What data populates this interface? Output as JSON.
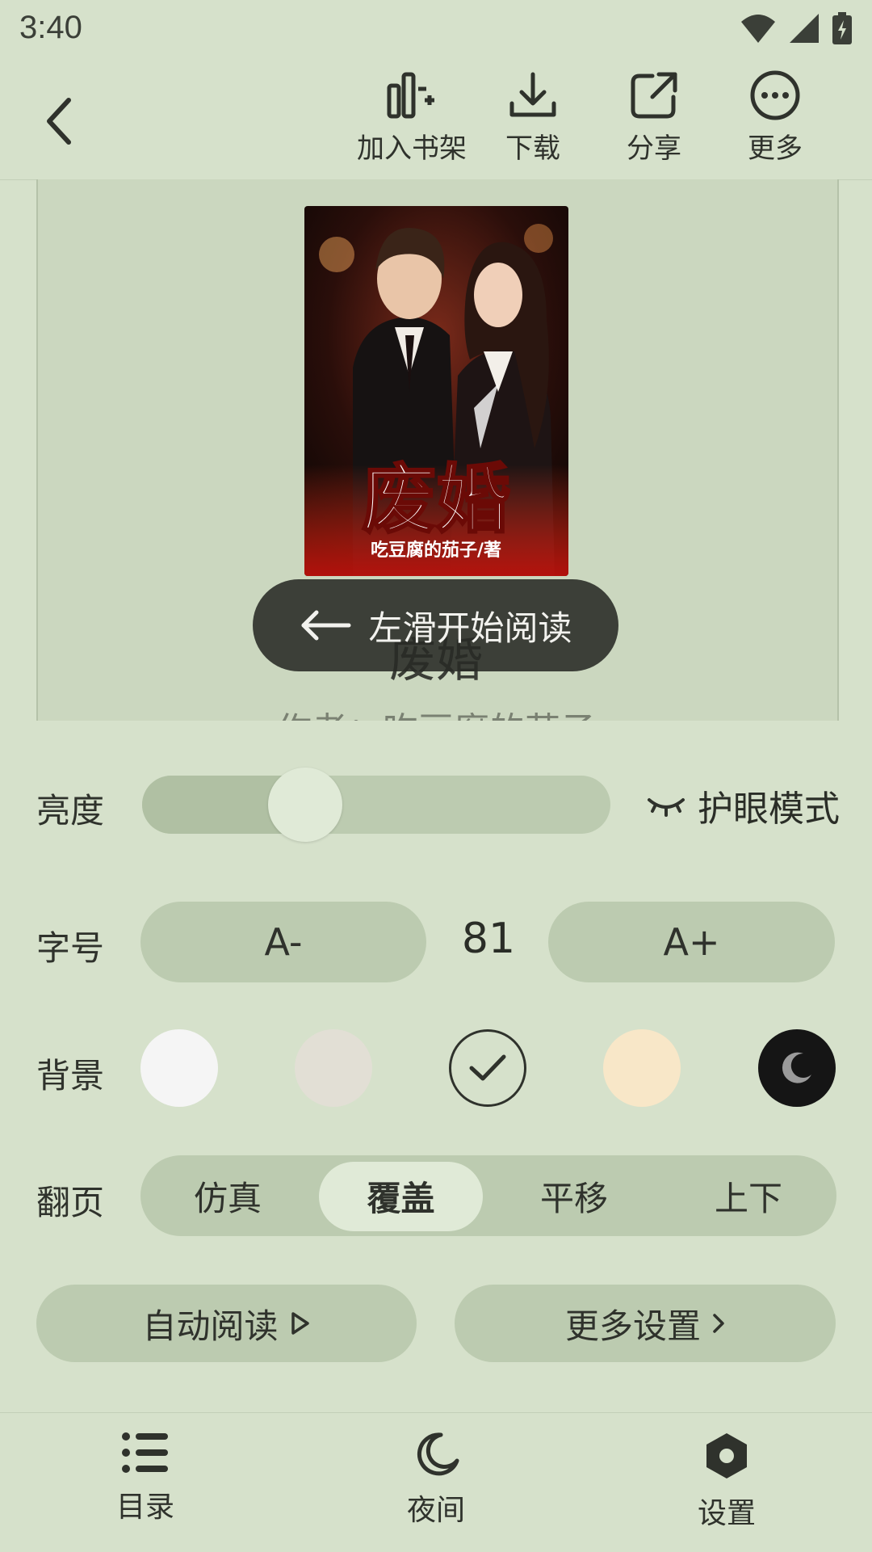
{
  "status_bar": {
    "time": "3:40"
  },
  "toolbar": {
    "back_icon": "chevron-left-icon",
    "actions": [
      {
        "label": "加入书架",
        "icon": "add-bookshelf-icon"
      },
      {
        "label": "下载",
        "icon": "download-icon"
      },
      {
        "label": "分享",
        "icon": "share-icon"
      },
      {
        "label": "更多",
        "icon": "more-icon"
      }
    ]
  },
  "book": {
    "cover_title": "废婚",
    "cover_author_line": "吃豆腐的茄子/著",
    "title": "废婚",
    "author": "作者：吃豆腐的茄子"
  },
  "swipe_hint": {
    "text": "左滑开始阅读",
    "icon": "arrow-left-icon"
  },
  "settings": {
    "brightness": {
      "label": "亮度",
      "level": 0.33,
      "eye_mode_label": "护眼模式",
      "eye_icon": "eye-closed-icon"
    },
    "font_size": {
      "label": "字号",
      "decrease": "A-",
      "value": "81",
      "increase": "A+"
    },
    "background": {
      "label": "背景",
      "swatches": [
        {
          "color": "#f5f5f5"
        },
        {
          "color": "#e2dfd5"
        },
        {
          "color": "#d6e1cb",
          "selected": true
        },
        {
          "color": "#f8e7c8"
        },
        {
          "color": "#151515",
          "icon": "moon-icon"
        }
      ]
    },
    "page_flip": {
      "label": "翻页",
      "options": [
        "仿真",
        "覆盖",
        "平移",
        "上下"
      ],
      "selected": "覆盖"
    },
    "auto_read": "自动阅读",
    "more_settings": "更多设置"
  },
  "bottom_nav": [
    {
      "label": "目录",
      "icon": "list-icon"
    },
    {
      "label": "夜间",
      "icon": "moon-icon"
    },
    {
      "label": "设置",
      "icon": "settings-icon"
    }
  ],
  "colors": {
    "background": "#d6e1cb",
    "control": "#bccbb0",
    "selected": "#e0ead7",
    "text": "#2f322c"
  }
}
